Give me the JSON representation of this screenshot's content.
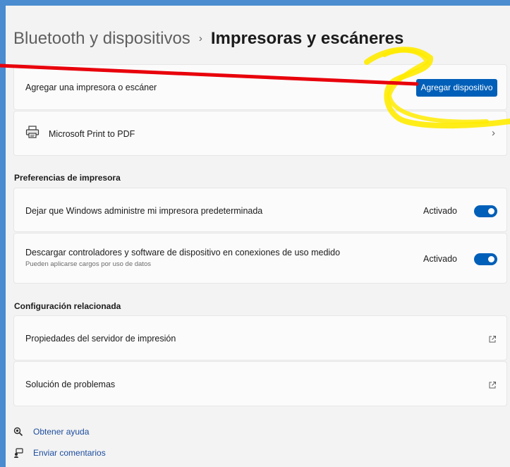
{
  "breadcrumb": {
    "parent": "Bluetooth y dispositivos",
    "separator": "›",
    "current": "Impresoras y escáneres"
  },
  "add_printer": {
    "label": "Agregar una impresora o escáner",
    "button_label": "Agregar dispositivo"
  },
  "printers": [
    {
      "name": "Microsoft Print to PDF",
      "icon": "printer-icon"
    }
  ],
  "printer_prefs": {
    "title": "Preferencias de impresora",
    "items": [
      {
        "label": "Dejar que Windows administre mi impresora predeterminada",
        "sub": "",
        "state_label": "Activado",
        "on": true
      },
      {
        "label": "Descargar controladores y software de dispositivo en conexiones de uso medido",
        "sub": "Pueden aplicarse cargos por uso de datos",
        "state_label": "Activado",
        "on": true
      }
    ]
  },
  "related": {
    "title": "Configuración relacionada",
    "items": [
      {
        "label": "Propiedades del servidor de impresión",
        "icon": "external-link-icon"
      },
      {
        "label": "Solución de problemas",
        "icon": "external-link-icon"
      }
    ]
  },
  "footer": {
    "help_label": "Obtener ayuda",
    "feedback_label": "Enviar comentarios"
  },
  "colors": {
    "accent": "#005fb8",
    "annotation_arrow": "#e8000b",
    "annotation_highlight": "#ffeb00",
    "link": "#1b4c9e",
    "frame": "#4a8ccf"
  }
}
